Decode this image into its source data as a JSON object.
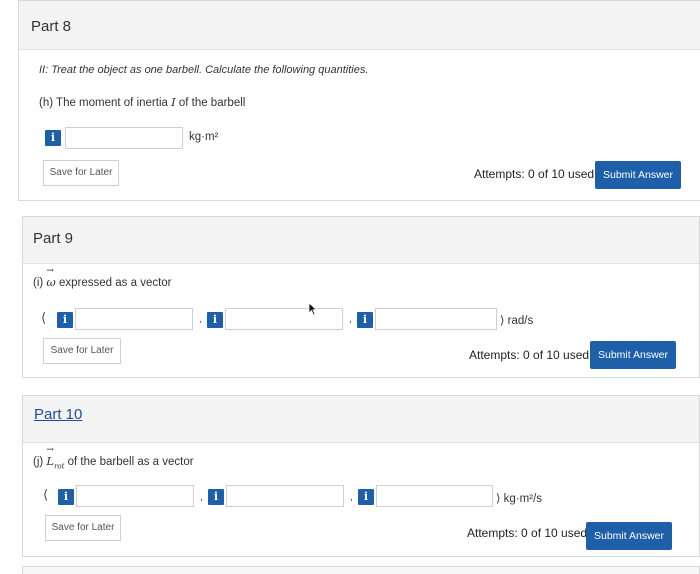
{
  "part8": {
    "title": "Part 8",
    "instruction": "II: Treat the object as one barbell. Calculate the following quantities.",
    "question_prefix": "(h) The moment of inertia ",
    "question_symbol": "I",
    "question_suffix": " of the barbell",
    "unit": "kg·m²",
    "save_label": "Save for Later",
    "attempts": "Attempts: 0 of 10 used",
    "submit_label": "Submit Answer"
  },
  "part9": {
    "title": "Part 9",
    "question_prefix": "(i) ",
    "question_symbol": "ω",
    "question_suffix": " expressed as a vector",
    "open_bracket": "⟨",
    "separator": ",",
    "close_unit": "⟩ rad/s",
    "save_label": "Save for Later",
    "attempts": "Attempts: 0 of 10 used",
    "submit_label": "Submit Answer"
  },
  "part10": {
    "title": "Part 10",
    "question_prefix": "(j) ",
    "question_symbol": "L",
    "question_subscript": "rot",
    "question_suffix": " of the barbell as a vector",
    "open_bracket": "⟨",
    "separator": ",",
    "close_unit": "⟩ kg·m²/s",
    "save_label": "Save for Later",
    "attempts": "Attempts: 0 of 10 used",
    "submit_label": "Submit Answer"
  },
  "icons": {
    "info": "i"
  },
  "colors": {
    "accent": "#1d5fa8",
    "header_bg": "#f3f3f3"
  }
}
